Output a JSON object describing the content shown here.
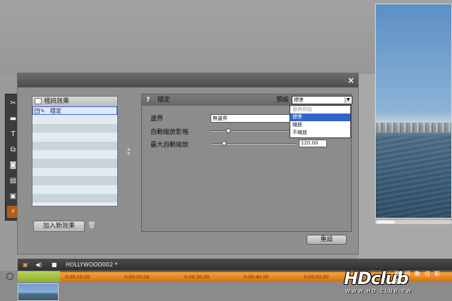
{
  "dialog": {
    "close_label": "×",
    "effects_list": {
      "header": "視訊效果",
      "items": [
        {
          "label": "穩定",
          "selected": true
        },
        {
          "label": ""
        },
        {
          "label": ""
        },
        {
          "label": ""
        },
        {
          "label": ""
        },
        {
          "label": ""
        },
        {
          "label": ""
        },
        {
          "label": ""
        },
        {
          "label": ""
        },
        {
          "label": ""
        },
        {
          "label": ""
        }
      ]
    },
    "add_effect_label": "加入新效果",
    "settings": {
      "help_label": "?",
      "title": "穩定",
      "preset_label": "預設",
      "preset_value": "標準",
      "border_label": "邊界",
      "border_value": "無邊界",
      "auto_zoom_label": "自動縮放影格",
      "max_zoom_label": "最大自動縮放",
      "max_zoom_value": "120.00",
      "auto_zoom_level": 0.2,
      "max_zoom_level": 0.15
    },
    "preset_dropdown": {
      "options": [
        {
          "label": "替換預設",
          "state": "disabled"
        },
        {
          "label": "標準",
          "state": "highlight"
        },
        {
          "label": "縮放",
          "state": "normal"
        },
        {
          "label": "不縮放",
          "state": "normal"
        }
      ]
    },
    "reset_label": "重設"
  },
  "toolbar": {
    "tools": [
      {
        "icon": "scissors-icon",
        "glyph": "✂"
      },
      {
        "icon": "title-card-icon",
        "glyph": "▬"
      },
      {
        "icon": "text-icon",
        "glyph": "T"
      },
      {
        "icon": "overlay-icon",
        "glyph": "⧉"
      },
      {
        "icon": "camera-icon",
        "glyph": "◙"
      },
      {
        "icon": "clapper-icon",
        "glyph": "▤"
      },
      {
        "icon": "frame-icon",
        "glyph": "▣"
      },
      {
        "icon": "effects-plug-icon",
        "glyph": "⚡",
        "active": true
      }
    ]
  },
  "timeline": {
    "project_name": "HOLLYWOOD002 *",
    "timecodes": [
      "0:00:10.00",
      "0:00:20.00",
      "0:00:30.00",
      "0:00:40.00",
      "0:00:50.00"
    ]
  },
  "watermark": {
    "logo": "HDclub",
    "chinese": "精研數位影音",
    "url": "WWW.HD.CLUB.TW"
  },
  "colors": {
    "accent_orange": "#e8861f",
    "selection_blue": "#3465c8"
  }
}
